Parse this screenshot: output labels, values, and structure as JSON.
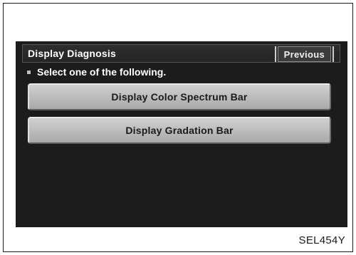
{
  "header": {
    "title": "Display Diagnosis",
    "previous_label": "Previous"
  },
  "instruction": "Select one of the following.",
  "options": [
    {
      "label": "Display Color Spectrum Bar"
    },
    {
      "label": "Display Gradation Bar"
    }
  ],
  "figure_code": "SEL454Y"
}
